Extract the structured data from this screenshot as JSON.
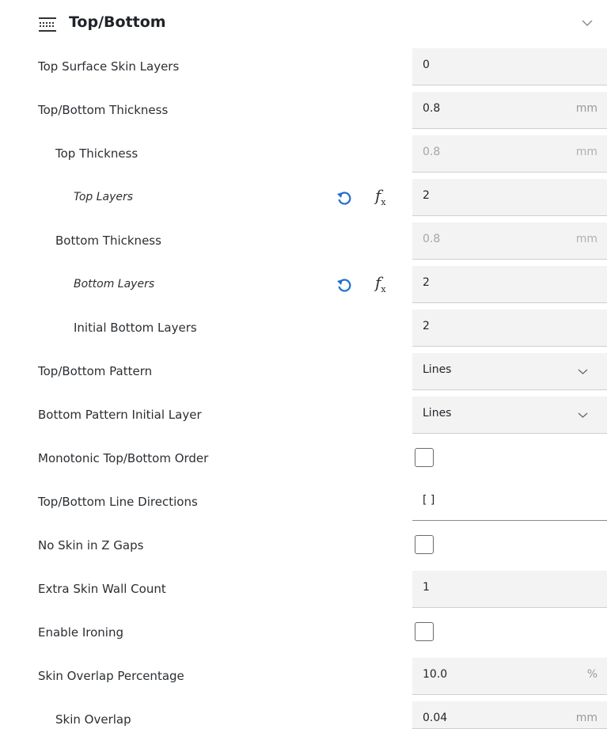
{
  "header": {
    "title": "Top/Bottom",
    "icon": "top-bottom-layers-icon"
  },
  "rows": [
    {
      "label": "Top Surface Skin Layers",
      "value": "0",
      "unit": ""
    },
    {
      "label": "Top/Bottom Thickness",
      "value": "0.8",
      "unit": "mm"
    },
    {
      "label": "Top Thickness",
      "value": "0.8",
      "unit": "mm"
    },
    {
      "label": "Top Layers",
      "value": "2",
      "unit": ""
    },
    {
      "label": "Bottom Thickness",
      "value": "0.8",
      "unit": "mm"
    },
    {
      "label": "Bottom Layers",
      "value": "2",
      "unit": ""
    },
    {
      "label": "Initial Bottom Layers",
      "value": "2",
      "unit": ""
    },
    {
      "label": "Top/Bottom Pattern",
      "value": "Lines",
      "unit": ""
    },
    {
      "label": "Bottom Pattern Initial Layer",
      "value": "Lines",
      "unit": ""
    },
    {
      "label": "Monotonic Top/Bottom Order",
      "checked": false
    },
    {
      "label": "Top/Bottom Line Directions",
      "value": "[ ]",
      "unit": ""
    },
    {
      "label": "No Skin in Z Gaps",
      "checked": false
    },
    {
      "label": "Extra Skin Wall Count",
      "value": "1",
      "unit": ""
    },
    {
      "label": "Enable Ironing",
      "checked": false
    },
    {
      "label": "Skin Overlap Percentage",
      "value": "10.0",
      "unit": "%"
    },
    {
      "label": "Skin Overlap",
      "value": "0.04",
      "unit": "mm"
    }
  ],
  "icons": {
    "reset": "reset-icon",
    "function": "function-icon"
  }
}
